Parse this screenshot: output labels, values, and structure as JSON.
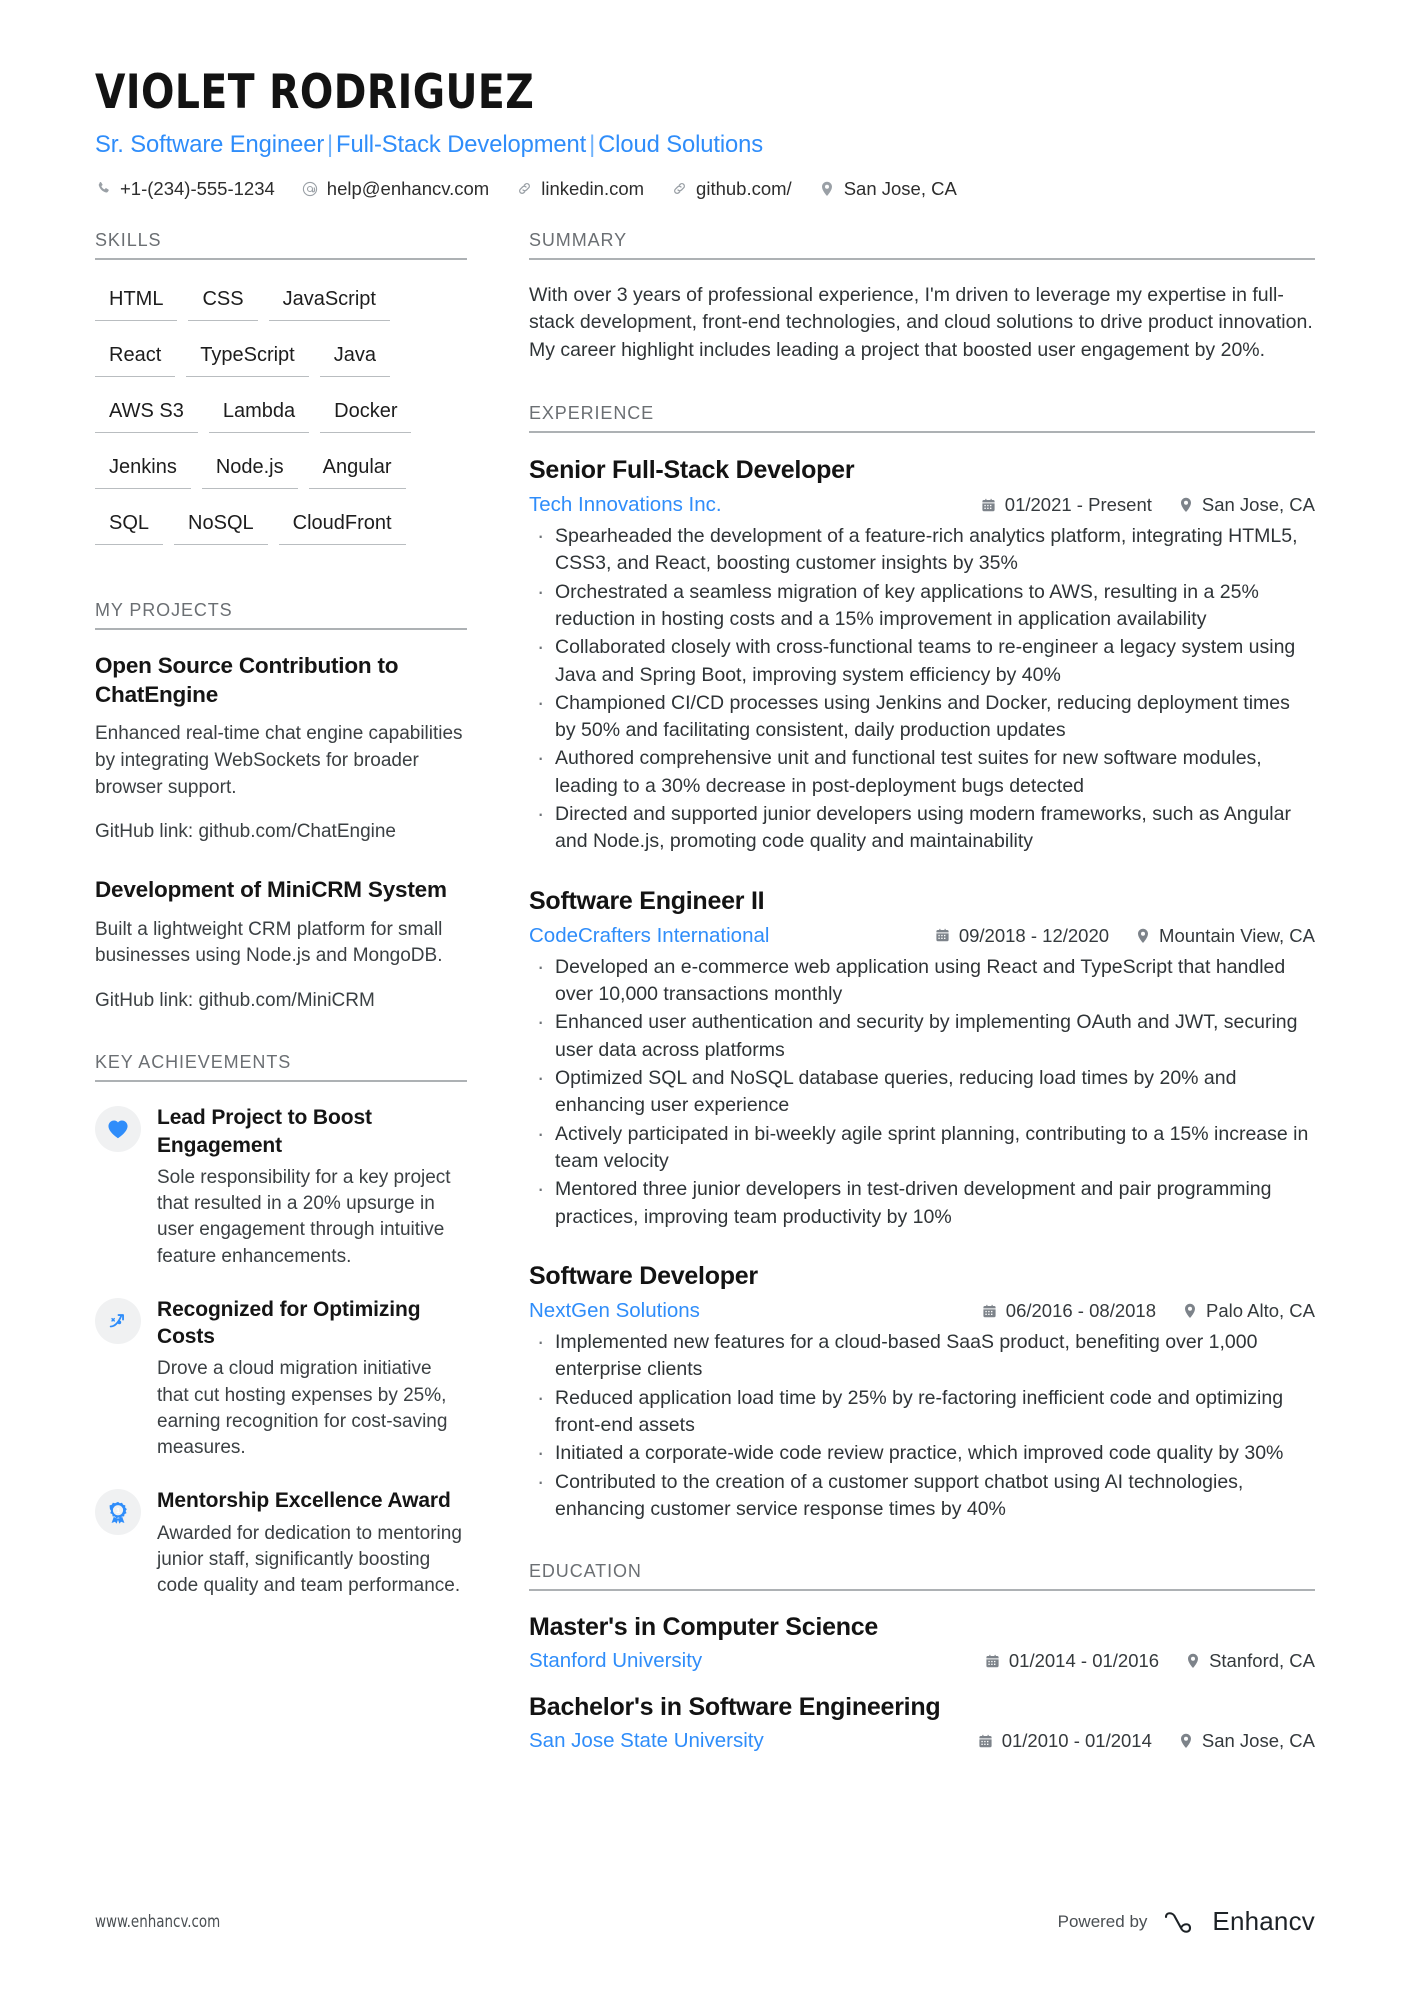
{
  "header": {
    "name": "VIOLET RODRIGUEZ",
    "headline_parts": [
      "Sr. Software Engineer",
      "Full-Stack Development",
      "Cloud Solutions"
    ],
    "headline_separator": "|",
    "contacts": [
      {
        "icon": "phone-icon",
        "text": "+1-(234)-555-1234"
      },
      {
        "icon": "email-icon",
        "text": "help@enhancv.com"
      },
      {
        "icon": "link-icon",
        "text": "linkedin.com"
      },
      {
        "icon": "link-icon",
        "text": "github.com/"
      },
      {
        "icon": "location-pin-icon",
        "text": "San Jose, CA"
      }
    ]
  },
  "colors": {
    "accent": "#2f8dfa",
    "heading": "#6b6f73",
    "text": "#2f3437",
    "rule": "#adb1b4",
    "badge_bg": "#f0f1f2"
  },
  "sidebar": {
    "skills": {
      "title": "SKILLS",
      "items": [
        "HTML",
        "CSS",
        "JavaScript",
        "React",
        "TypeScript",
        "Java",
        "AWS S3",
        "Lambda",
        "Docker",
        "Jenkins",
        "Node.js",
        "Angular",
        "SQL",
        "NoSQL",
        "CloudFront"
      ]
    },
    "projects": {
      "title": "MY PROJECTS",
      "items": [
        {
          "title": "Open Source Contribution to ChatEngine",
          "description": "Enhanced real-time chat engine capabilities by integrating WebSockets for broader browser support.",
          "link": "GitHub link: github.com/ChatEngine"
        },
        {
          "title": "Development of MiniCRM System",
          "description": "Built a lightweight CRM platform for small businesses using Node.js and MongoDB.",
          "link": "GitHub link: github.com/MiniCRM"
        }
      ]
    },
    "achievements": {
      "title": "KEY ACHIEVEMENTS",
      "items": [
        {
          "icon": "heart-icon",
          "title": "Lead Project to Boost Engagement",
          "description": "Sole responsibility for a key project that resulted in a 20% upsurge in user engagement through intuitive feature enhancements."
        },
        {
          "icon": "trending-up-icon",
          "title": "Recognized for Optimizing Costs",
          "description": "Drove a cloud migration initiative that cut hosting expenses by 25%, earning recognition for cost-saving measures."
        },
        {
          "icon": "award-ribbon-icon",
          "title": "Mentorship Excellence Award",
          "description": "Awarded for dedication to mentoring junior staff, significantly boosting code quality and team performance."
        }
      ]
    }
  },
  "main": {
    "summary": {
      "title": "SUMMARY",
      "text": "With over 3 years of professional experience, I'm driven to leverage my expertise in full-stack development, front-end technologies, and cloud solutions to drive product innovation. My career highlight includes leading a project that boosted user engagement by 20%."
    },
    "experience": {
      "title": "EXPERIENCE",
      "jobs": [
        {
          "title": "Senior Full-Stack Developer",
          "company": "Tech Innovations Inc.",
          "dates": "01/2021 - Present",
          "location": "San Jose, CA",
          "bullets": [
            "Spearheaded the development of a feature-rich analytics platform, integrating HTML5, CSS3, and React, boosting customer insights by 35%",
            "Orchestrated a seamless migration of key applications to AWS, resulting in a 25% reduction in hosting costs and a 15% improvement in application availability",
            "Collaborated closely with cross-functional teams to re-engineer a legacy system using Java and Spring Boot, improving system efficiency by 40%",
            "Championed CI/CD processes using Jenkins and Docker, reducing deployment times by 50% and facilitating consistent, daily production updates",
            "Authored comprehensive unit and functional test suites for new software modules, leading to a 30% decrease in post-deployment bugs detected",
            "Directed and supported junior developers using modern frameworks, such as Angular and Node.js, promoting code quality and maintainability"
          ]
        },
        {
          "title": "Software Engineer II",
          "company": "CodeCrafters International",
          "dates": "09/2018 - 12/2020",
          "location": "Mountain View, CA",
          "bullets": [
            "Developed an e-commerce web application using React and TypeScript that handled over 10,000 transactions monthly",
            "Enhanced user authentication and security by implementing OAuth and JWT, securing user data across platforms",
            "Optimized SQL and NoSQL database queries, reducing load times by 20% and enhancing user experience",
            "Actively participated in bi-weekly agile sprint planning, contributing to a 15% increase in team velocity",
            "Mentored three junior developers in test-driven development and pair programming practices, improving team productivity by 10%"
          ]
        },
        {
          "title": "Software Developer",
          "company": "NextGen Solutions",
          "dates": "06/2016 - 08/2018",
          "location": "Palo Alto, CA",
          "bullets": [
            "Implemented new features for a cloud-based SaaS product, benefiting over 1,000 enterprise clients",
            "Reduced application load time by 25% by re-factoring inefficient code and optimizing front-end assets",
            "Initiated a corporate-wide code review practice, which improved code quality by 30%",
            "Contributed to the creation of a customer support chatbot using AI technologies, enhancing customer service response times by 40%"
          ]
        }
      ]
    },
    "education": {
      "title": "EDUCATION",
      "items": [
        {
          "degree": "Master's in Computer Science",
          "school": "Stanford University",
          "dates": "01/2014 - 01/2016",
          "location": "Stanford, CA"
        },
        {
          "degree": "Bachelor's in Software Engineering",
          "school": "San Jose State University",
          "dates": "01/2010 - 01/2014",
          "location": "San Jose, CA"
        }
      ]
    }
  },
  "footer": {
    "url": "www.enhancv.com",
    "powered_by": "Powered by",
    "brand_name": "Enhancv"
  }
}
